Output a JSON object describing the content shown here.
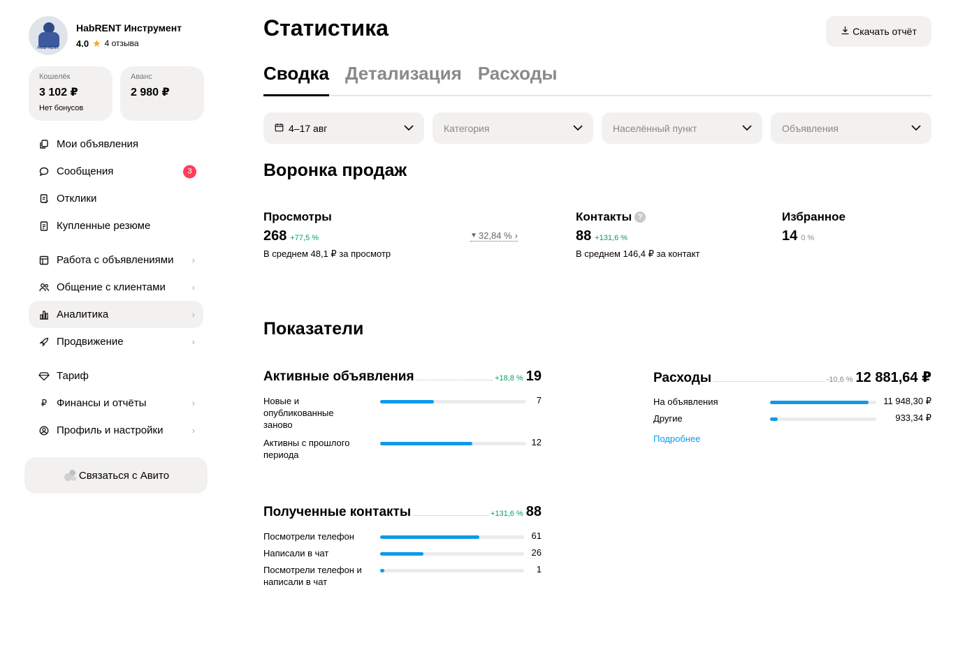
{
  "profile": {
    "name": "HabRENT Инструмент",
    "rating": "4.0",
    "reviews": "4 отзыва",
    "avatar_text": "HUB RENT"
  },
  "wallet": {
    "label": "Кошелёк",
    "value": "3 102 ₽",
    "note": "Нет бонусов"
  },
  "advance": {
    "label": "Аванс",
    "value": "2 980 ₽"
  },
  "menu": {
    "my_ads": "Мои объявления",
    "messages": "Сообщения",
    "messages_badge": "3",
    "responses": "Отклики",
    "resumes": "Купленные резюме",
    "ads_work": "Работа с объявлениями",
    "clients": "Общение с клиентами",
    "analytics": "Аналитика",
    "promotion": "Продвижение",
    "tariff": "Тариф",
    "finance": "Финансы и отчёты",
    "settings": "Профиль и настройки"
  },
  "contact_button": "Связаться с Авито",
  "page_title": "Статистика",
  "download_button": "Скачать отчёт",
  "tabs": [
    "Сводка",
    "Детализация",
    "Расходы"
  ],
  "filters": {
    "date": "4–17 авг",
    "category": "Категория",
    "locality": "Населённый пункт",
    "ads": "Объявления"
  },
  "funnel": {
    "title": "Воронка продаж",
    "views": {
      "title": "Просмотры",
      "value": "268",
      "delta": "+77,5 %",
      "note": "В среднем 48,1 ₽ за просмотр"
    },
    "conversion": "32,84 %",
    "contacts": {
      "title": "Контакты",
      "value": "88",
      "delta": "+131,6 %",
      "note": "В среднем 146,4 ₽ за контакт"
    },
    "favorites": {
      "title": "Избранное",
      "value": "14",
      "delta": "0 %"
    }
  },
  "indicators": {
    "title": "Показатели",
    "active_ads": {
      "title": "Активные объявления",
      "delta": "+18,8 %",
      "total": "19",
      "rows": [
        {
          "label": "Новые и опубликованные заново",
          "value": "7",
          "fraction": 0.37
        },
        {
          "label": "Активны с прошлого периода",
          "value": "12",
          "fraction": 0.63
        }
      ]
    },
    "contacts": {
      "title": "Полученные контакты",
      "delta": "+131,6 %",
      "total": "88",
      "rows": [
        {
          "label": "Посмотрели телефон",
          "value": "61",
          "fraction": 0.69
        },
        {
          "label": "Написали в чат",
          "value": "26",
          "fraction": 0.3
        },
        {
          "label": "Посмотрели телефон и написали в чат",
          "value": "1",
          "fraction": 0.02
        }
      ]
    },
    "expenses": {
      "title": "Расходы",
      "delta": "-10,6 %",
      "total": "12 881,64 ₽",
      "rows": [
        {
          "label": "На объявления",
          "value": "11 948,30 ₽",
          "fraction": 0.93
        },
        {
          "label": "Другие",
          "value": "933,34 ₽",
          "fraction": 0.07
        }
      ],
      "more": "Подробнее"
    }
  },
  "colors": {
    "accent_blue": "#0e9ae8",
    "positive_green": "#00a35c",
    "badge_red": "#ff3e5b",
    "surface_grey": "#f2f1f0"
  }
}
